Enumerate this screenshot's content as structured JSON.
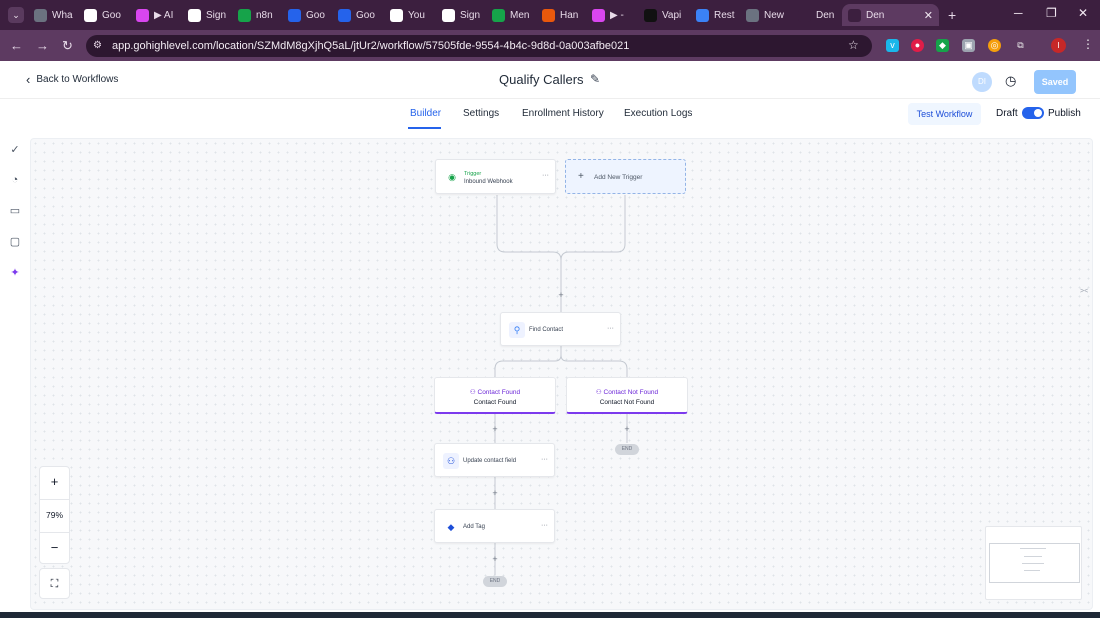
{
  "browser": {
    "tabs": [
      {
        "label": "Wha",
        "icon": "globe-icon",
        "color": "#6b7280"
      },
      {
        "label": "Goo",
        "icon": "docs-icon",
        "color": "#ffffff"
      },
      {
        "label": "▶ AI",
        "icon": "make-icon",
        "color": "#d946ef"
      },
      {
        "label": "Sign",
        "icon": "google-icon",
        "color": "#ffffff"
      },
      {
        "label": "n8n",
        "icon": "sheets-icon",
        "color": "#16a34a"
      },
      {
        "label": "Goo",
        "icon": "docs-icon",
        "color": "#2563eb"
      },
      {
        "label": "Goo",
        "icon": "docs-icon",
        "color": "#2563eb"
      },
      {
        "label": "You",
        "icon": "gmail-icon",
        "color": "#ffffff"
      },
      {
        "label": "Sign",
        "icon": "google-icon",
        "color": "#ffffff"
      },
      {
        "label": "Men",
        "icon": "sheets-icon",
        "color": "#16a34a"
      },
      {
        "label": "Han",
        "icon": "asterisk-icon",
        "color": "#ea580c"
      },
      {
        "label": "▶ -",
        "icon": "make-icon",
        "color": "#d946ef"
      },
      {
        "label": "Vapi",
        "icon": "vapi-icon",
        "color": "#111111"
      },
      {
        "label": "Rest",
        "icon": "form-icon",
        "color": "#3b82f6"
      },
      {
        "label": "New",
        "icon": "globe-icon",
        "color": "#6b7280"
      },
      {
        "label": "Den",
        "icon": "blank-icon",
        "color": "#3c1f3f"
      },
      {
        "label": "Den",
        "icon": "blank-icon",
        "color": "#3c1f3f"
      }
    ],
    "url": "app.gohighlevel.com/location/SZMdM8gXjhQ5aL/jtUr2/workflow/57505fde-9554-4b4c-9d8d-0a003afbe021"
  },
  "header": {
    "back_label": "Back to Workflows",
    "title": "Qualify Callers",
    "avatar_initials": "DI",
    "saved_label": "Saved"
  },
  "subnav": {
    "tabs": [
      "Builder",
      "Settings",
      "Enrollment History",
      "Execution Logs"
    ],
    "active": "Builder",
    "test_label": "Test Workflow",
    "draft_label": "Draft",
    "publish_label": "Publish",
    "published": true
  },
  "canvas": {
    "trigger": {
      "title": "Trigger",
      "subtitle": "Inbound Webhook"
    },
    "add_trigger_label": "Add New Trigger",
    "find_contact_label": "Find Contact",
    "branches": [
      {
        "title": "Contact Found",
        "subtitle": "Contact Found"
      },
      {
        "title": "Contact Not Found",
        "subtitle": "Contact Not Found"
      }
    ],
    "update_field_label": "Update contact field",
    "add_tag_label": "Add Tag",
    "end_label": "END",
    "zoom": "79%"
  }
}
